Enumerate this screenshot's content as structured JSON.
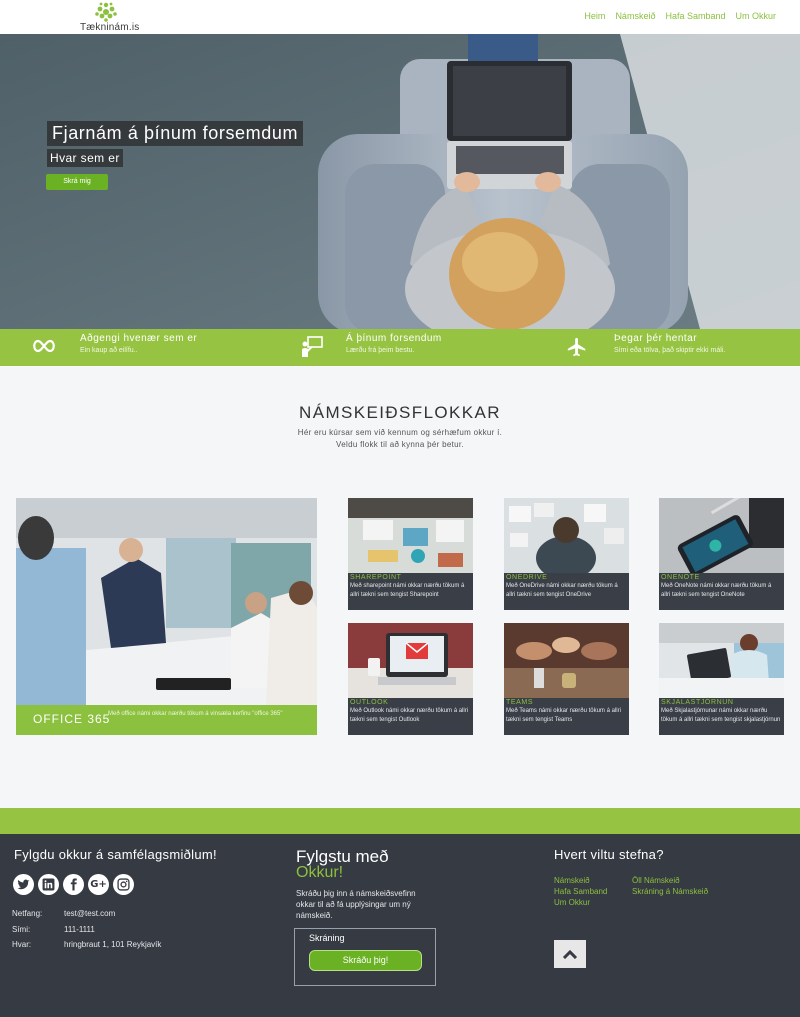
{
  "header": {
    "logo_text": "Tækninám.is",
    "nav": [
      "Heim",
      "Námskeið",
      "Hafa Samband",
      "Um Okkur"
    ]
  },
  "hero": {
    "title": "Fjarnám á þínum forsemdum",
    "subtitle": "Hvar sem er",
    "button": "Skrá mig"
  },
  "features": [
    {
      "icon": "infinity-icon",
      "title": "Aðgengi hvenær sem er",
      "desc": "Ein kaup að eilífu.."
    },
    {
      "icon": "presentation-icon",
      "title": "Á þínum forsendum",
      "desc": "Lærðu frá þeim bestu."
    },
    {
      "icon": "airplane-icon",
      "title": "Þegar þér hentar",
      "desc": "Sími eða tölva, það skiptir ekki máli."
    }
  ],
  "categories": {
    "title": "NÁMSKEIÐSFLOKKAR",
    "line1": "Hér eru kúrsar sem við kennum og sérhæfum okkur í.",
    "line2": "Veldu flokk til að kynna þér betur.",
    "featured": {
      "title": "OFFICE 365",
      "desc": "Með office námi okkar nærðu tökum á vinsæla kerfinu \"office 365\""
    },
    "cards": [
      {
        "title": "SHAREPOINT",
        "desc": "Með sharepoint námi okkar nærðu tökum á allri tækni sem tengist Sharepoint"
      },
      {
        "title": "ONEDRIVE",
        "desc": "Með OneDrive námi okkar nærðu tökum á allri tækni sem tengist OneDrive"
      },
      {
        "title": "ONENOTE",
        "desc": "Með OneNote námi okkar nærðu tökum á allri tækni sem tengist OneNote"
      },
      {
        "title": "OUTLOOK",
        "desc": "Með Outlook námi okkar nærðu tökum á allri tækni sem tengist Outlook"
      },
      {
        "title": "TEAMS",
        "desc": "Með Teams námi okkar nærðu tökum á allri tækni sem tengist Teams"
      },
      {
        "title": "SKJALASTJÓRNUN",
        "desc": "Með Skjalastjórnunar námi okkar nærðu tökum á allri tækni sem tengist skjalastjórnun"
      }
    ]
  },
  "footer": {
    "social_heading": "Fylgdu okkur á samfélagsmiðlum!",
    "social_icons": [
      "twitter-icon",
      "linkedin-icon",
      "facebook-icon",
      "google-plus-icon",
      "instagram-icon"
    ],
    "contact": [
      {
        "label": "Netfang:",
        "value": "test@test.com"
      },
      {
        "label": "Sími:",
        "value": "111-1111"
      },
      {
        "label": "Hvar:",
        "value": "hringbraut 1, 101 Reykjavík"
      }
    ],
    "follow_1": "Fylgstu með",
    "follow_2": "Okkur!",
    "follow_desc": "Skráðu þig inn á námskeiðsvefinn okkar til að fá upplýsingar um ný námskeið.",
    "signup_label": "Skráning",
    "signup_button": "Skráðu þig!",
    "where_heading": "Hvert viltu stefna?",
    "links_col1": [
      "Námskeið",
      "Hafa Samband",
      "Um Okkur"
    ],
    "links_col2": [
      "Öll Námskeið",
      "Skráning á Námskeið"
    ]
  },
  "colors": {
    "accent": "#96c442",
    "button": "#6ab123",
    "dark": "#363a42"
  }
}
